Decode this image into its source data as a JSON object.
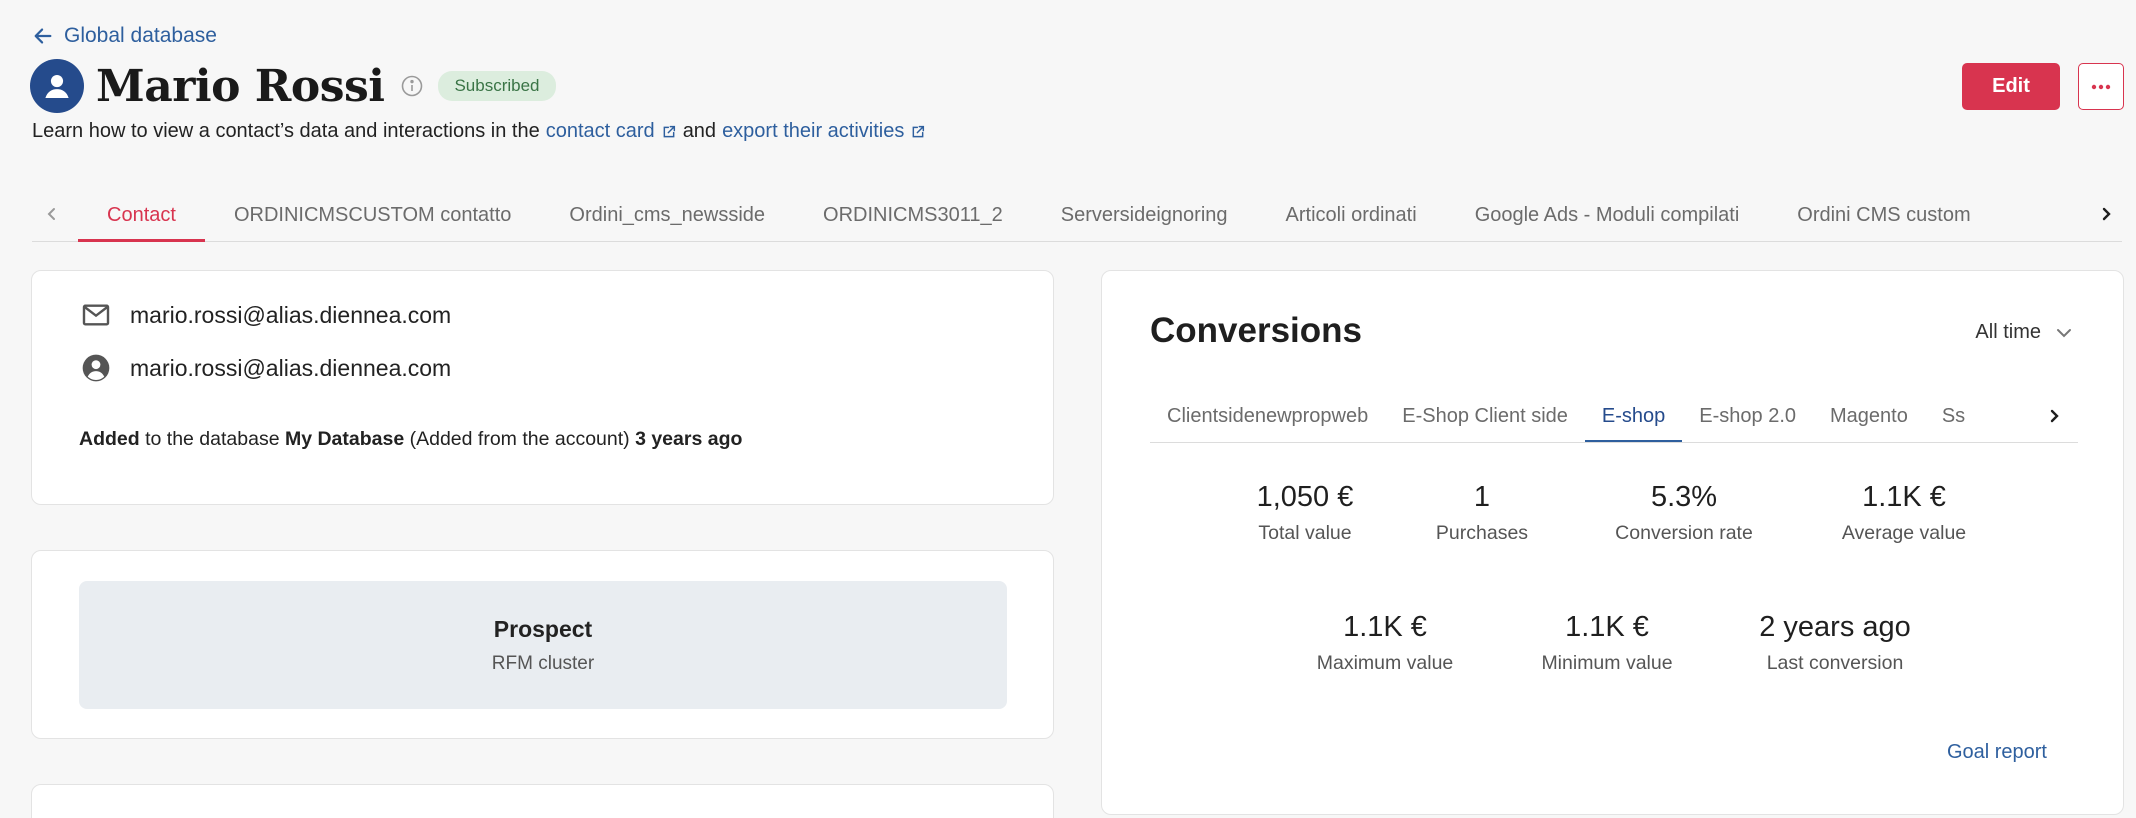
{
  "header": {
    "back_label": "Global database",
    "name": "Mario Rossi",
    "badge": "Subscribed",
    "help_prefix": "Learn how to view a contact’s data and interactions in the",
    "help_link1": "contact card",
    "help_mid": "and",
    "help_link2": "export their activities",
    "edit_label": "Edit"
  },
  "tabs": [
    "Contact",
    "ORDINICMSCUSTOM contatto",
    "Ordini_cms_newsside",
    "ORDINICMS3011_2",
    "Serversideignoring",
    "Articoli ordinati",
    "Google Ads - Moduli compilati",
    "Ordini CMS custom"
  ],
  "contact": {
    "email": "mario.rossi@alias.diennea.com",
    "identifier": "mario.rossi@alias.diennea.com",
    "added_word": "Added",
    "added_text1": "to the database",
    "database": "My Database",
    "added_text2": "(Added from the account)",
    "added_when": "3 years ago"
  },
  "rfm": {
    "title": "Prospect",
    "subtitle": "RFM cluster"
  },
  "conversions": {
    "title": "Conversions",
    "period": "All time",
    "tabs": [
      "Clientsidenewpropweb",
      "E-Shop Client side",
      "E-shop",
      "E-shop 2.0",
      "Magento",
      "Ss"
    ],
    "stats": [
      {
        "value": "1,050 €",
        "label": "Total value"
      },
      {
        "value": "1",
        "label": "Purchases"
      },
      {
        "value": "5.3%",
        "label": "Conversion rate"
      },
      {
        "value": "1.1K €",
        "label": "Average value"
      },
      {
        "value": "1.1K €",
        "label": "Maximum value"
      },
      {
        "value": "1.1K €",
        "label": "Minimum value"
      },
      {
        "value": "2 years ago",
        "label": "Last conversion"
      }
    ],
    "goal_report": "Goal report"
  },
  "colors": {
    "brand_red": "#d8344f",
    "link_blue": "#2e5f9e",
    "avatar_blue": "#254b8c",
    "badge_green_bg": "#dcedde"
  }
}
